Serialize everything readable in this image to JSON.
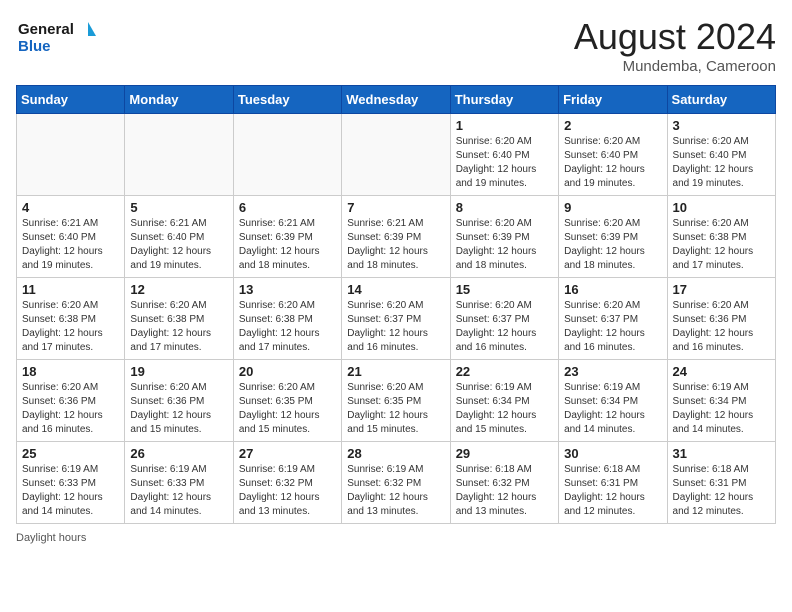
{
  "header": {
    "logo_line1": "General",
    "logo_line2": "Blue",
    "month_year": "August 2024",
    "location": "Mundemba, Cameroon"
  },
  "weekdays": [
    "Sunday",
    "Monday",
    "Tuesday",
    "Wednesday",
    "Thursday",
    "Friday",
    "Saturday"
  ],
  "weeks": [
    [
      {
        "day": "",
        "info": ""
      },
      {
        "day": "",
        "info": ""
      },
      {
        "day": "",
        "info": ""
      },
      {
        "day": "",
        "info": ""
      },
      {
        "day": "1",
        "info": "Sunrise: 6:20 AM\nSunset: 6:40 PM\nDaylight: 12 hours\nand 19 minutes."
      },
      {
        "day": "2",
        "info": "Sunrise: 6:20 AM\nSunset: 6:40 PM\nDaylight: 12 hours\nand 19 minutes."
      },
      {
        "day": "3",
        "info": "Sunrise: 6:20 AM\nSunset: 6:40 PM\nDaylight: 12 hours\nand 19 minutes."
      }
    ],
    [
      {
        "day": "4",
        "info": "Sunrise: 6:21 AM\nSunset: 6:40 PM\nDaylight: 12 hours\nand 19 minutes."
      },
      {
        "day": "5",
        "info": "Sunrise: 6:21 AM\nSunset: 6:40 PM\nDaylight: 12 hours\nand 19 minutes."
      },
      {
        "day": "6",
        "info": "Sunrise: 6:21 AM\nSunset: 6:39 PM\nDaylight: 12 hours\nand 18 minutes."
      },
      {
        "day": "7",
        "info": "Sunrise: 6:21 AM\nSunset: 6:39 PM\nDaylight: 12 hours\nand 18 minutes."
      },
      {
        "day": "8",
        "info": "Sunrise: 6:20 AM\nSunset: 6:39 PM\nDaylight: 12 hours\nand 18 minutes."
      },
      {
        "day": "9",
        "info": "Sunrise: 6:20 AM\nSunset: 6:39 PM\nDaylight: 12 hours\nand 18 minutes."
      },
      {
        "day": "10",
        "info": "Sunrise: 6:20 AM\nSunset: 6:38 PM\nDaylight: 12 hours\nand 17 minutes."
      }
    ],
    [
      {
        "day": "11",
        "info": "Sunrise: 6:20 AM\nSunset: 6:38 PM\nDaylight: 12 hours\nand 17 minutes."
      },
      {
        "day": "12",
        "info": "Sunrise: 6:20 AM\nSunset: 6:38 PM\nDaylight: 12 hours\nand 17 minutes."
      },
      {
        "day": "13",
        "info": "Sunrise: 6:20 AM\nSunset: 6:38 PM\nDaylight: 12 hours\nand 17 minutes."
      },
      {
        "day": "14",
        "info": "Sunrise: 6:20 AM\nSunset: 6:37 PM\nDaylight: 12 hours\nand 16 minutes."
      },
      {
        "day": "15",
        "info": "Sunrise: 6:20 AM\nSunset: 6:37 PM\nDaylight: 12 hours\nand 16 minutes."
      },
      {
        "day": "16",
        "info": "Sunrise: 6:20 AM\nSunset: 6:37 PM\nDaylight: 12 hours\nand 16 minutes."
      },
      {
        "day": "17",
        "info": "Sunrise: 6:20 AM\nSunset: 6:36 PM\nDaylight: 12 hours\nand 16 minutes."
      }
    ],
    [
      {
        "day": "18",
        "info": "Sunrise: 6:20 AM\nSunset: 6:36 PM\nDaylight: 12 hours\nand 16 minutes."
      },
      {
        "day": "19",
        "info": "Sunrise: 6:20 AM\nSunset: 6:36 PM\nDaylight: 12 hours\nand 15 minutes."
      },
      {
        "day": "20",
        "info": "Sunrise: 6:20 AM\nSunset: 6:35 PM\nDaylight: 12 hours\nand 15 minutes."
      },
      {
        "day": "21",
        "info": "Sunrise: 6:20 AM\nSunset: 6:35 PM\nDaylight: 12 hours\nand 15 minutes."
      },
      {
        "day": "22",
        "info": "Sunrise: 6:19 AM\nSunset: 6:34 PM\nDaylight: 12 hours\nand 15 minutes."
      },
      {
        "day": "23",
        "info": "Sunrise: 6:19 AM\nSunset: 6:34 PM\nDaylight: 12 hours\nand 14 minutes."
      },
      {
        "day": "24",
        "info": "Sunrise: 6:19 AM\nSunset: 6:34 PM\nDaylight: 12 hours\nand 14 minutes."
      }
    ],
    [
      {
        "day": "25",
        "info": "Sunrise: 6:19 AM\nSunset: 6:33 PM\nDaylight: 12 hours\nand 14 minutes."
      },
      {
        "day": "26",
        "info": "Sunrise: 6:19 AM\nSunset: 6:33 PM\nDaylight: 12 hours\nand 14 minutes."
      },
      {
        "day": "27",
        "info": "Sunrise: 6:19 AM\nSunset: 6:32 PM\nDaylight: 12 hours\nand 13 minutes."
      },
      {
        "day": "28",
        "info": "Sunrise: 6:19 AM\nSunset: 6:32 PM\nDaylight: 12 hours\nand 13 minutes."
      },
      {
        "day": "29",
        "info": "Sunrise: 6:18 AM\nSunset: 6:32 PM\nDaylight: 12 hours\nand 13 minutes."
      },
      {
        "day": "30",
        "info": "Sunrise: 6:18 AM\nSunset: 6:31 PM\nDaylight: 12 hours\nand 12 minutes."
      },
      {
        "day": "31",
        "info": "Sunrise: 6:18 AM\nSunset: 6:31 PM\nDaylight: 12 hours\nand 12 minutes."
      }
    ]
  ],
  "footer": {
    "note": "Daylight hours"
  }
}
